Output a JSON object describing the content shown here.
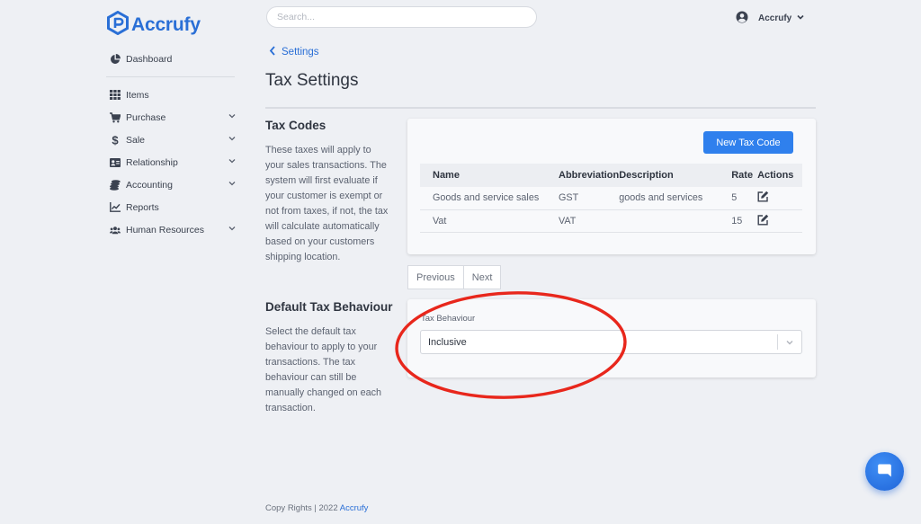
{
  "app": {
    "name": "Accrufy"
  },
  "search": {
    "placeholder": "Search..."
  },
  "user": {
    "name": "Accrufy"
  },
  "sidebar": {
    "dashboard": {
      "label": "Dashboard",
      "icon": "pie-chart-icon"
    },
    "items": [
      {
        "label": "Items",
        "icon": "grid-icon",
        "expandable": false
      },
      {
        "label": "Purchase",
        "icon": "cart-icon",
        "expandable": true
      },
      {
        "label": "Sale",
        "icon": "dollar-icon",
        "expandable": true
      },
      {
        "label": "Relationship",
        "icon": "contact-card-icon",
        "expandable": true
      },
      {
        "label": "Accounting",
        "icon": "coins-icon",
        "expandable": true
      },
      {
        "label": "Reports",
        "icon": "line-chart-icon",
        "expandable": false
      },
      {
        "label": "Human Resources",
        "icon": "users-icon",
        "expandable": true
      }
    ]
  },
  "breadcrumb": {
    "label": "Settings"
  },
  "page": {
    "title": "Tax Settings"
  },
  "tax_codes": {
    "title": "Tax Codes",
    "description": "These taxes will apply to your sales transactions. The system will first evaluate if your customer is exempt or not from taxes, if not, the tax will calculate automatically based on your customers shipping location.",
    "new_button": "New Tax Code",
    "columns": [
      "Name",
      "Abbreviation",
      "Description",
      "Rate",
      "Actions"
    ],
    "rows": [
      {
        "name": "Goods and service sales",
        "abbreviation": "GST",
        "description": "goods and services",
        "rate": "5"
      },
      {
        "name": "Vat",
        "abbreviation": "VAT",
        "description": "",
        "rate": "15"
      }
    ],
    "pagination": {
      "previous": "Previous",
      "next": "Next"
    }
  },
  "default_tax": {
    "title": "Default Tax Behaviour",
    "description": "Select the default tax behaviour to apply to your transactions. The tax behaviour can still be manually changed on each transaction.",
    "field_label": "Tax Behaviour",
    "selected": "Inclusive"
  },
  "footer": {
    "text": "Copy Rights | 2022",
    "brand": "Accrufy"
  },
  "colors": {
    "accent": "#2f80ed",
    "brand": "#2a6fd6",
    "annotation": "#e8271c"
  }
}
